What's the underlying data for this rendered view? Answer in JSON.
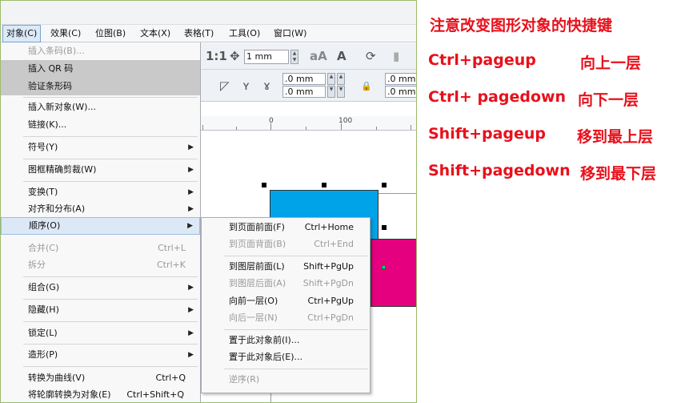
{
  "menubar": [
    {
      "label": "对象(C)",
      "active": true
    },
    {
      "label": "效果(C)"
    },
    {
      "label": "位图(B)"
    },
    {
      "label": "文本(X)"
    },
    {
      "label": "表格(T)"
    },
    {
      "label": "工具(O)"
    },
    {
      "label": "窗口(W)"
    }
  ],
  "toolbar": {
    "width_value": "1 mm",
    "coord_x": ".0 mm",
    "coord_y": ".0 mm",
    "coord_x2": ".0 mm",
    "coord_y2": ".0 mm"
  },
  "ruler": {
    "label_0": "0",
    "label_100": "100"
  },
  "object_menu": [
    {
      "label": "插入条码(B)...",
      "disabled": true
    },
    {
      "label": "插入 QR 码",
      "highlight": "grey"
    },
    {
      "label": "验证条形码",
      "highlight": "grey"
    },
    {
      "label": "插入新对象(W)..."
    },
    {
      "label": "链接(K)..."
    },
    {
      "label": "符号(Y)",
      "submenu": true
    },
    {
      "label": "图框精确剪裁(W)",
      "submenu": true
    },
    {
      "label": "变换(T)",
      "submenu": true
    },
    {
      "label": "对齐和分布(A)",
      "submenu": true
    },
    {
      "label": "顺序(O)",
      "submenu": true,
      "highlight": "hover"
    },
    {
      "label": "合并(C)",
      "shortcut": "Ctrl+L",
      "disabled": true
    },
    {
      "label": "拆分",
      "shortcut": "Ctrl+K",
      "disabled": true
    },
    {
      "label": "组合(G)",
      "submenu": true
    },
    {
      "label": "隐藏(H)",
      "submenu": true
    },
    {
      "label": "锁定(L)",
      "submenu": true
    },
    {
      "label": "造形(P)",
      "submenu": true
    },
    {
      "label": "转换为曲线(V)",
      "shortcut": "Ctrl+Q"
    },
    {
      "label": "将轮廓转换为对象(E)",
      "shortcut": "Ctrl+Shift+Q"
    }
  ],
  "order_submenu": [
    {
      "label": "到页面前面(F)",
      "shortcut": "Ctrl+Home"
    },
    {
      "label": "到页面背面(B)",
      "shortcut": "Ctrl+End",
      "disabled": true
    },
    {
      "label": "到图层前面(L)",
      "shortcut": "Shift+PgUp"
    },
    {
      "label": "到图层后面(A)",
      "shortcut": "Shift+PgDn",
      "disabled": true
    },
    {
      "label": "向前一层(O)",
      "shortcut": "Ctrl+PgUp"
    },
    {
      "label": "向后一层(N)",
      "shortcut": "Ctrl+PgDn",
      "disabled": true
    },
    {
      "label": "置于此对象前(I)..."
    },
    {
      "label": "置于此对象后(E)..."
    },
    {
      "label": "逆序(R)",
      "disabled": true
    }
  ],
  "notes": {
    "title": "注意改变图形对象的快捷键",
    "items": [
      {
        "key": "Ctrl+pageup",
        "desc": "向上一层"
      },
      {
        "key": "Ctrl+ pagedown",
        "desc": "向下一层"
      },
      {
        "key": "Shift+pageup",
        "desc": "移到最上层"
      },
      {
        "key": "Shift+pagedown",
        "desc": "移到最下层"
      }
    ]
  },
  "colors": {
    "blue_rect": "#00a3e8",
    "magenta_rect": "#e4007f",
    "note_red": "#e8101b",
    "frame_green": "#9bbb6b"
  }
}
